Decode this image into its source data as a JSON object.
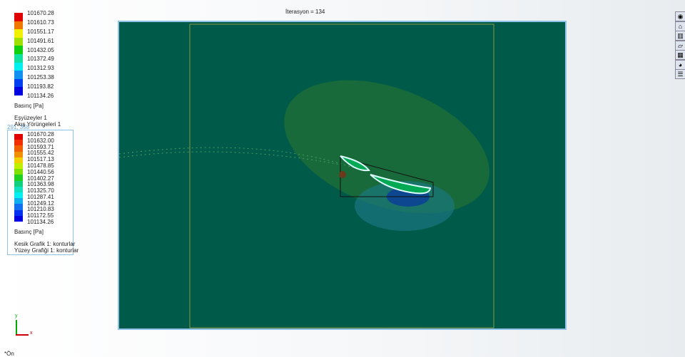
{
  "top_legend": {
    "values": [
      "101670.28",
      "101610.73",
      "101551.17",
      "101491.61",
      "101432.05",
      "101372.49",
      "101312.93",
      "101253.38",
      "101193.82",
      "101134.26"
    ],
    "colors": [
      "#e00000",
      "#f07800",
      "#f0f000",
      "#a0e000",
      "#10d010",
      "#10e0a0",
      "#00f0f0",
      "#1090f0",
      "#0040f0",
      "#0000e0"
    ],
    "unit": "Basınç [Pa]",
    "lines": [
      "Eşyüzeyler 1",
      "Akış Yörüngeleri 1"
    ]
  },
  "coord": "291, 358",
  "box_legend": {
    "values": [
      "101670.28",
      "101632.00",
      "101593.71",
      "101555.42",
      "101517.13",
      "101478.85",
      "101440.56",
      "101402.27",
      "101363.98",
      "101325.70",
      "101287.41",
      "101249.12",
      "101210.83",
      "101172.55",
      "101134.26"
    ],
    "colors": [
      "#e00000",
      "#f03000",
      "#f06000",
      "#f09000",
      "#f0d000",
      "#c0f000",
      "#80e000",
      "#20d020",
      "#10d080",
      "#10e0c0",
      "#00f0f0",
      "#10b0f0",
      "#1070f0",
      "#0030f0",
      "#0000e0"
    ],
    "unit": "Basınç [Pa]",
    "lines": [
      "Kesik Grafik 1: konturlar",
      "Yüzey Grafiği 1: konturlar"
    ]
  },
  "iteration": "İterasyon = 134",
  "axis": {
    "x": "x",
    "y": "y"
  },
  "view_label": "*Ön",
  "side_icons": [
    "globe-icon",
    "home-icon",
    "parts-icon",
    "folder-icon",
    "appearance-icon",
    "color-icon",
    "list-icon"
  ]
}
